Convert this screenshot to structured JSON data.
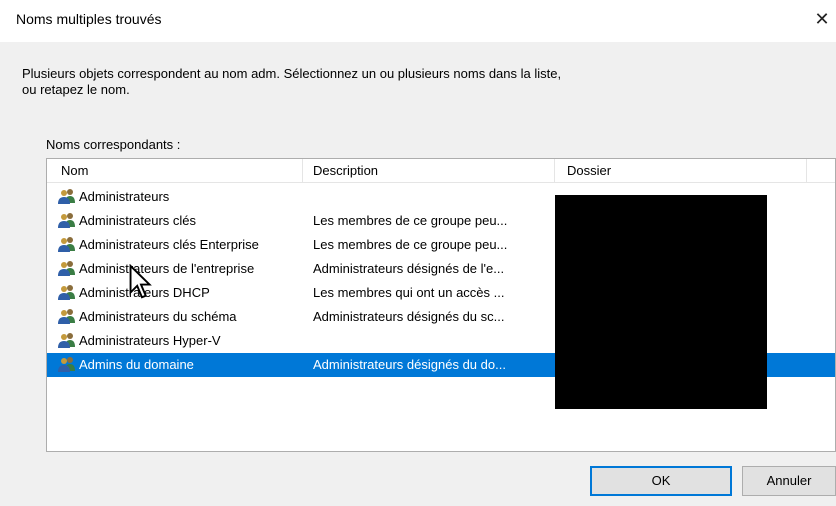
{
  "dialog": {
    "title": "Noms multiples trouvés",
    "close_glyph": "✕",
    "prompt": "Plusieurs objets correspondent au nom adm. Sélectionnez un ou plusieurs noms dans la liste, ou retapez le nom.",
    "list_label": "Noms correspondants :",
    "columns": {
      "name": "Nom",
      "description": "Description",
      "folder": "Dossier"
    },
    "rows": [
      {
        "name": "Administrateurs",
        "description": "",
        "selected": false,
        "icon": "group-icon"
      },
      {
        "name": "Administrateurs clés",
        "description": "Les membres de ce groupe peu...",
        "selected": false,
        "icon": "group-icon"
      },
      {
        "name": "Administrateurs clés Enterprise",
        "description": "Les membres de ce groupe peu...",
        "selected": false,
        "icon": "group-icon"
      },
      {
        "name": "Administrateurs de l'entreprise",
        "description": "Administrateurs désignés de l'e...",
        "selected": false,
        "icon": "group-icon"
      },
      {
        "name": "Administrateurs DHCP",
        "description": "Les membres qui ont un accès ...",
        "selected": false,
        "icon": "group-icon"
      },
      {
        "name": "Administrateurs du schéma",
        "description": "Administrateurs désignés du sc...",
        "selected": false,
        "icon": "group-icon"
      },
      {
        "name": "Administrateurs Hyper-V",
        "description": "",
        "selected": false,
        "icon": "group-icon"
      },
      {
        "name": "Admins du domaine",
        "description": "Administrateurs désignés du do...",
        "selected": true,
        "icon": "group-icon"
      }
    ],
    "buttons": {
      "ok": "OK",
      "cancel": "Annuler"
    },
    "colors": {
      "selection": "#0078d7",
      "client_bg": "#f0f0f0",
      "redaction": "#000000"
    }
  }
}
